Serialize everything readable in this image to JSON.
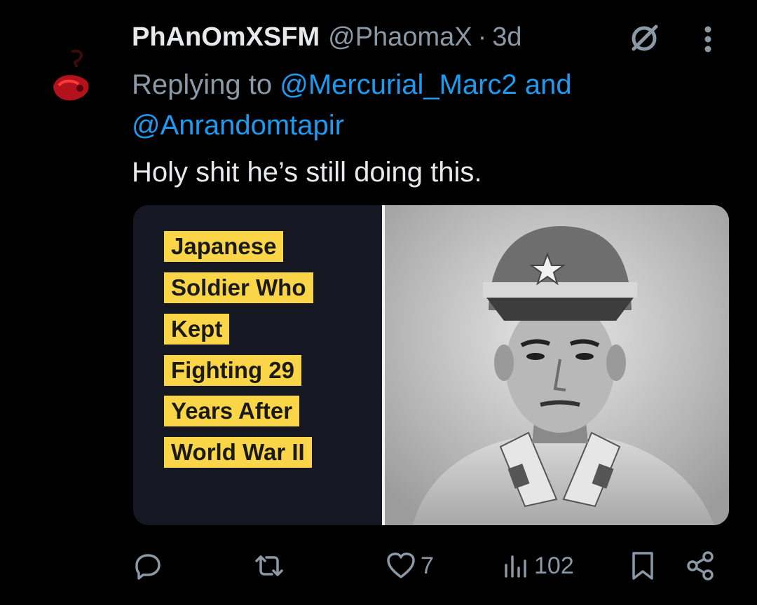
{
  "tweet": {
    "display_name": "PhAnOmXSFM",
    "handle": "@PhaomaX",
    "separator": "·",
    "time": "3d",
    "reply_prefix": "Replying to",
    "reply_mention_1": "@Mercurial_Marc2",
    "reply_and": "and",
    "reply_mention_2": "@Anrandomtapir",
    "text": "Holy shit he’s still doing this."
  },
  "media": {
    "caption_lines": [
      "Japanese",
      "Soldier Who",
      "Kept",
      "Fighting 29",
      "Years After",
      "World War II"
    ],
    "caption_color": "#f9d547",
    "photo_subject": "soldier-portrait"
  },
  "actions": {
    "reply_icon": "reply-icon",
    "retweet_icon": "retweet-icon",
    "like_icon": "heart-icon",
    "like_count": "7",
    "views_icon": "views-icon",
    "views_count": "102",
    "bookmark_icon": "bookmark-icon",
    "share_icon": "share-icon"
  },
  "colors": {
    "background": "#000000",
    "text": "#e7e9ea",
    "muted": "#8b98a5",
    "link": "#1d9bf0"
  }
}
